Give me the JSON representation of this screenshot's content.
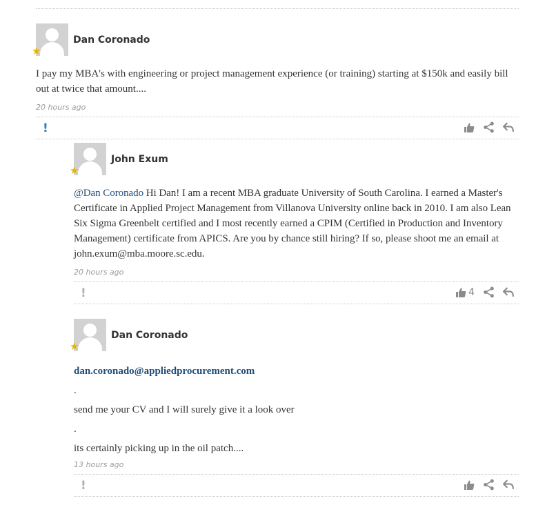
{
  "comments": [
    {
      "author": "Dan Coronado",
      "body": "I pay my MBA's with engineering or project management experience (or training) starting at $150k and easily bill out at twice that amount....",
      "time": "20 hours ago",
      "flag": "!"
    },
    {
      "author": "John Exum",
      "mention": "@Dan Coronado",
      "body": "  Hi Dan!  I am a recent MBA graduate University of South Carolina.  I earned a Master's Certificate in Applied Project Management from Villanova University online back in 2010.  I am also Lean Six Sigma Greenbelt certified and I most recently earned a CPIM (Certified in Production and Inventory Management) certificate from APICS.  Are you by chance still hiring?  If so, please shoot me an email at john.exum@mba.moore.sc.edu.",
      "time": "20 hours ago",
      "flag": "!",
      "likes": "4"
    },
    {
      "author": "Dan Coronado",
      "email": "dan.coronado@appliedprocurement.com",
      "dot1": ".",
      "line1": "send me your CV and I will surely give it a look over",
      "dot2": ".",
      "line2": "its certainly picking up in the oil patch....",
      "time": "13 hours ago",
      "flag": "!"
    }
  ],
  "icons": {
    "star": "star-icon",
    "like": "thumbs-up-icon",
    "share": "share-icon",
    "reply": "reply-icon"
  },
  "colors": {
    "star": "#e7b400",
    "mention": "#1f4e79",
    "flag_active": "#2a7ec2"
  }
}
